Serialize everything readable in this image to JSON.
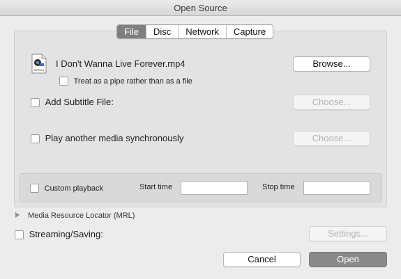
{
  "window": {
    "title": "Open Source"
  },
  "tabs": [
    {
      "label": "File",
      "active": true
    },
    {
      "label": "Disc",
      "active": false
    },
    {
      "label": "Network",
      "active": false
    },
    {
      "label": "Capture",
      "active": false
    }
  ],
  "file": {
    "name": "I Don't Wanna Live Forever.mp4",
    "icon_label": "MPEG4",
    "browse_label": "Browse...",
    "pipe_label": "Treat as a pipe rather than as a file",
    "pipe_checked": false
  },
  "subtitle": {
    "label": "Add Subtitle File:",
    "checked": false,
    "choose_label": "Choose..."
  },
  "sync_media": {
    "label": "Play another media synchronously",
    "checked": false,
    "choose_label": "Choose..."
  },
  "playback": {
    "custom_label": "Custom playback",
    "custom_checked": false,
    "start_label": "Start time",
    "start_value": "",
    "stop_label": "Stop time",
    "stop_value": ""
  },
  "mrl": {
    "label": "Media Resource Locator (MRL)"
  },
  "streaming": {
    "label": "Streaming/Saving:",
    "checked": false,
    "settings_label": "Settings..."
  },
  "actions": {
    "cancel_label": "Cancel",
    "open_label": "Open"
  },
  "colors": {
    "active_tab": "#7f7f7f",
    "primary_button": "#8a8a8a",
    "disabled_text": "#b3b3b3"
  }
}
